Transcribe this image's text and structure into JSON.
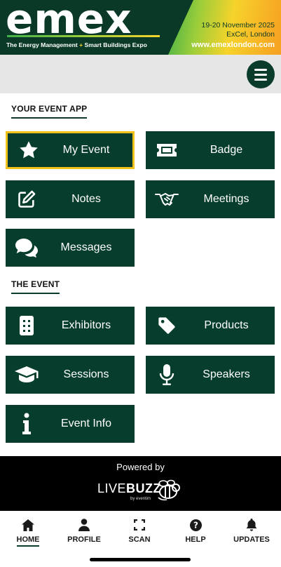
{
  "banner": {
    "logo": "emex",
    "tagline_part1": "The Energy Management",
    "tagline_plus": "+",
    "tagline_part2": "Smart Buildings Expo",
    "dates": "19-20 November 2025",
    "venue": "ExCel, London",
    "website": "www.emexlondon.com"
  },
  "sections": {
    "event_app": "YOUR EVENT APP",
    "the_event": "THE EVENT"
  },
  "tiles": {
    "my_event": {
      "label": "My Event",
      "icon": "star-icon"
    },
    "badge": {
      "label": "Badge",
      "icon": "ticket-icon"
    },
    "notes": {
      "label": "Notes",
      "icon": "edit-icon"
    },
    "meetings": {
      "label": "Meetings",
      "icon": "handshake-icon"
    },
    "messages": {
      "label": "Messages",
      "icon": "chat-bubbles-icon"
    },
    "exhibitors": {
      "label": "Exhibitors",
      "icon": "building-icon"
    },
    "products": {
      "label": "Products",
      "icon": "tag-icon"
    },
    "sessions": {
      "label": "Sessions",
      "icon": "graduation-cap-icon"
    },
    "speakers": {
      "label": "Speakers",
      "icon": "microphone-icon"
    },
    "event_info": {
      "label": "Event Info",
      "icon": "info-icon"
    }
  },
  "footer": {
    "powered_by": "Powered by",
    "brand_light": "LIVE",
    "brand_bold": "BUZZ",
    "brand_sub": "by eventim"
  },
  "tabbar": [
    {
      "label": "HOME",
      "icon": "home-icon"
    },
    {
      "label": "PROFILE",
      "icon": "person-icon"
    },
    {
      "label": "SCAN",
      "icon": "scan-icon"
    },
    {
      "label": "HELP",
      "icon": "help-icon"
    },
    {
      "label": "UPDATES",
      "icon": "bell-icon"
    }
  ],
  "colors": {
    "tile": "#063d2c",
    "selected_border": "#f2c21c",
    "banner": "#0a3a27"
  }
}
